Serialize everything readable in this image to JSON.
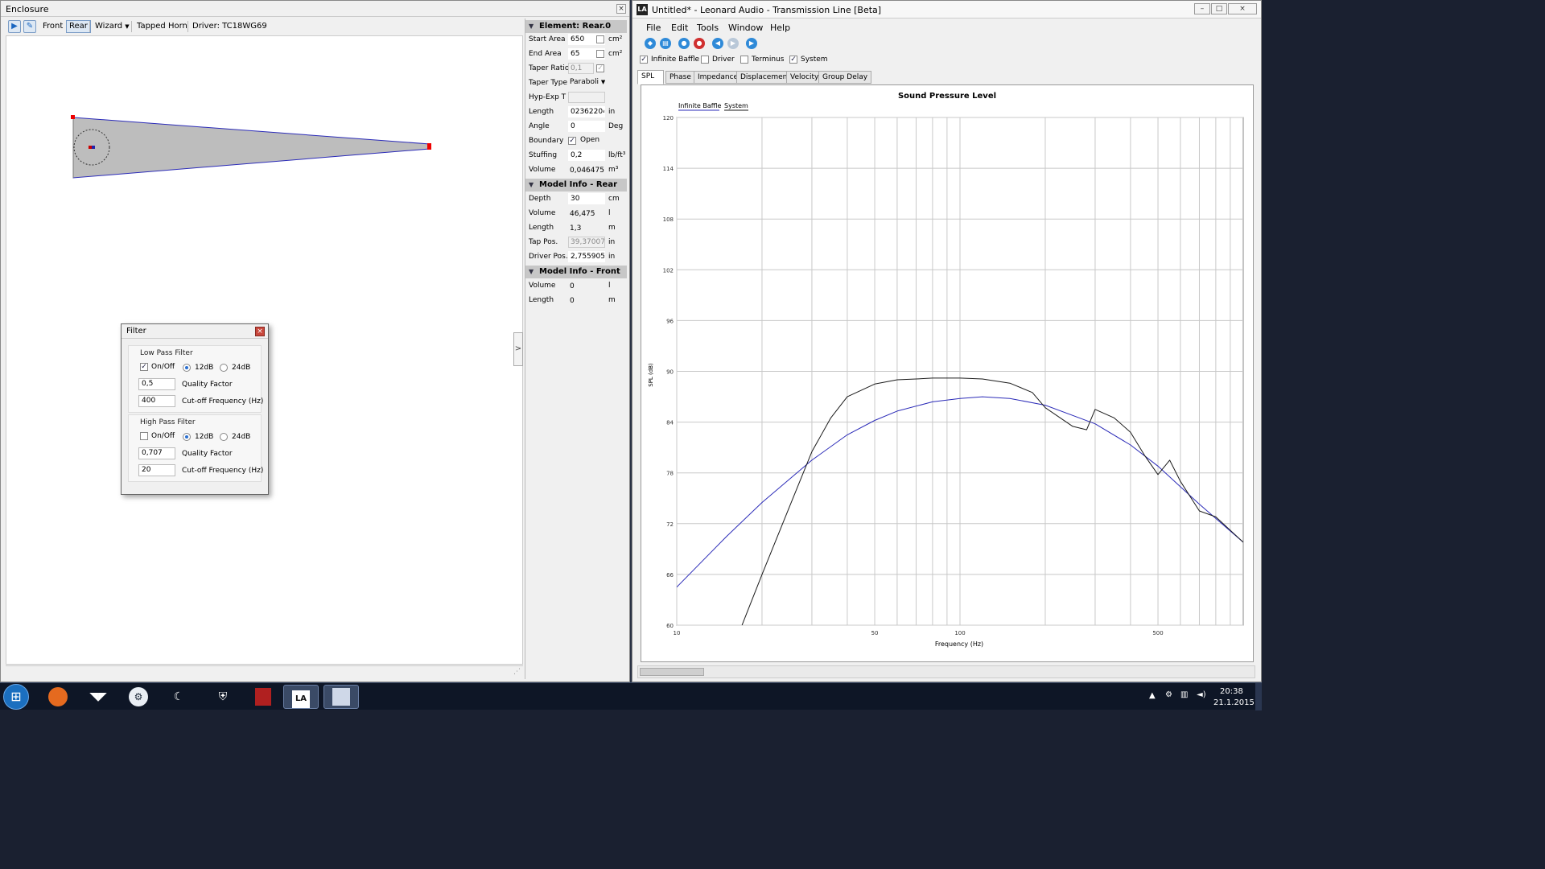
{
  "left_window": {
    "title": "Enclosure",
    "toolbar": {
      "front": "Front",
      "rear": "Rear",
      "wizard": "Wizard",
      "type": "Tapped Horn",
      "driver": "Driver: TC18WG69"
    },
    "splitter_arrow": ">"
  },
  "filter": {
    "title": "Filter",
    "low_pass": {
      "title": "Low Pass Filter",
      "on_off": "On/Off",
      "on": true,
      "slope_12": "12dB",
      "slope_24": "24dB",
      "selected_slope": "12dB",
      "q": "0,5",
      "q_label": "Quality Factor",
      "fc": "400",
      "fc_label": "Cut-off Frequency (Hz)"
    },
    "high_pass": {
      "title": "High Pass Filter",
      "on_off": "On/Off",
      "on": false,
      "slope_12": "12dB",
      "slope_24": "24dB",
      "selected_slope": "12dB",
      "q": "0,707",
      "q_label": "Quality Factor",
      "fc": "20",
      "fc_label": "Cut-off Frequency (Hz)"
    }
  },
  "properties": {
    "element": {
      "header": "Element: Rear.0",
      "start_area": {
        "label": "Start Area",
        "value": "650",
        "unit": "cm²"
      },
      "end_area": {
        "label": "End Area",
        "value": "65",
        "unit": "cm²"
      },
      "taper_ratio": {
        "label": "Taper Ratio",
        "value": "0,1"
      },
      "taper_type": {
        "label": "Taper Type",
        "value": "Paraboli"
      },
      "hyp_exp": {
        "label": "Hyp-Exp T",
        "value": ""
      },
      "length": {
        "label": "Length",
        "value": "023622047",
        "unit": "in"
      },
      "angle": {
        "label": "Angle",
        "value": "0",
        "unit": "Deg"
      },
      "boundary": {
        "label": "Boundary",
        "value": "Open"
      },
      "stuffing": {
        "label": "Stuffing",
        "value": "0,2",
        "unit": "lb/ft³"
      },
      "volume": {
        "label": "Volume",
        "value": "0,046475",
        "unit": "m³"
      }
    },
    "model_rear": {
      "header": "Model Info - Rear",
      "depth": {
        "label": "Depth",
        "value": "30",
        "unit": "cm"
      },
      "volume": {
        "label": "Volume",
        "value": "46,475",
        "unit": "l"
      },
      "length": {
        "label": "Length",
        "value": "1,3",
        "unit": "m"
      },
      "tap_pos": {
        "label": "Tap Pos.",
        "value": "39,3700787",
        "unit": "in"
      },
      "driver_pos": {
        "label": "Driver Pos.",
        "value": "2,7559055",
        "unit": "in"
      }
    },
    "model_front": {
      "header": "Model Info - Front",
      "volume": {
        "label": "Volume",
        "value": "0",
        "unit": "l"
      },
      "length": {
        "label": "Length",
        "value": "0",
        "unit": "m"
      }
    }
  },
  "right_window": {
    "title": "Untitled* - Leonard Audio - Transmission Line [Beta]",
    "logo": "LA",
    "menu": [
      "File",
      "Edit",
      "Tools",
      "Window",
      "Help"
    ],
    "options": [
      {
        "label": "Infinite Baffle",
        "checked": true
      },
      {
        "label": "Driver",
        "checked": false
      },
      {
        "label": "Terminus",
        "checked": false
      },
      {
        "label": "System",
        "checked": true
      }
    ],
    "tabs": [
      "SPL",
      "Phase",
      "Impedance",
      "Displacement",
      "Velocity",
      "Group Delay"
    ],
    "active_tab": "SPL"
  },
  "chart_data": {
    "type": "line",
    "title": "Sound Pressure Level",
    "xlabel": "Frequency (Hz)",
    "ylabel": "SPL (dB)",
    "x_scale": "log",
    "xlim": [
      10,
      1000
    ],
    "ylim": [
      60,
      120
    ],
    "x_ticks": [
      10,
      50,
      100,
      500
    ],
    "y_ticks": [
      60,
      66,
      72,
      78,
      84,
      90,
      96,
      102,
      108,
      114,
      120
    ],
    "grid": true,
    "legend_position": "top-left",
    "legend": [
      "Infinite Baffle",
      "System"
    ],
    "series": [
      {
        "name": "Infinite Baffle",
        "color": "#2b2bb8",
        "x": [
          10,
          15,
          20,
          30,
          40,
          50,
          60,
          80,
          100,
          120,
          150,
          200,
          300,
          400,
          500,
          700,
          1000
        ],
        "y": [
          64.5,
          70.5,
          74.5,
          79.5,
          82.5,
          84.2,
          85.3,
          86.4,
          86.8,
          87,
          86.8,
          86,
          83.8,
          81.3,
          78.8,
          74.3,
          69.8
        ]
      },
      {
        "name": "System",
        "color": "#1a1a1a",
        "x": [
          17,
          20,
          25,
          30,
          35,
          40,
          50,
          60,
          70,
          80,
          100,
          120,
          150,
          180,
          200,
          250,
          280,
          300,
          350,
          400,
          450,
          500,
          550,
          600,
          700,
          800,
          1000
        ],
        "y": [
          60,
          66,
          74,
          80.5,
          84.5,
          87,
          88.5,
          89,
          89.1,
          89.2,
          89.2,
          89.1,
          88.6,
          87.5,
          85.7,
          83.5,
          83.1,
          85.5,
          84.5,
          82.8,
          80,
          77.8,
          79.5,
          77,
          73.5,
          72.8,
          69.8
        ]
      }
    ]
  },
  "taskbar": {
    "time": "20:38",
    "date": "21.1.2015"
  }
}
